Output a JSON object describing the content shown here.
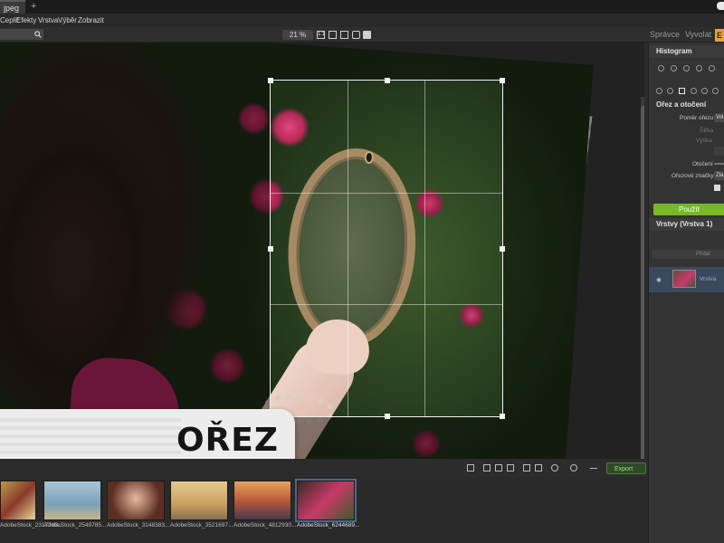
{
  "tab": {
    "title": "jpeg",
    "add": "+"
  },
  "menu": {
    "items": [
      "Ceplit",
      "Efekty",
      "Vrstva",
      "Výběr",
      "Zobrazit"
    ]
  },
  "toolbar": {
    "zoom": "21 %",
    "zoom_fit": "1:1"
  },
  "modes": {
    "spravce": "Správce",
    "vyvolat": "Vyvolat",
    "edit": "E"
  },
  "overlay": {
    "label": "OŘEZ"
  },
  "panel": {
    "histogram": "Histogram",
    "crop_title": "Ořez a otočení",
    "aspect_label": "Poměr ořezu",
    "aspect_value": "Vol",
    "width_label": "Šířka",
    "height_label": "Výška",
    "rotation_label": "Otočení",
    "crop_marks_label": "Ořezové značky",
    "crop_marks_value": "Zla",
    "apply": "Použít",
    "layers_header": "Vrstvy (Vrstva 1)",
    "layer_add": "Přidat",
    "layer_name": "Vrstva"
  },
  "bottom": {
    "export": "Export"
  },
  "filmstrip": [
    {
      "label": "AdobeStock_2317740..."
    },
    {
      "label": "AdobeStock_2549785..."
    },
    {
      "label": "AdobeStock_3148383..."
    },
    {
      "label": "AdobeStock_3521697..."
    },
    {
      "label": "AdobeStock_4812930..."
    },
    {
      "label": "AdobeStock_6244689..."
    }
  ],
  "colors": {
    "apply_green": "#76b82a",
    "accent_orange": "#e8a13a"
  }
}
